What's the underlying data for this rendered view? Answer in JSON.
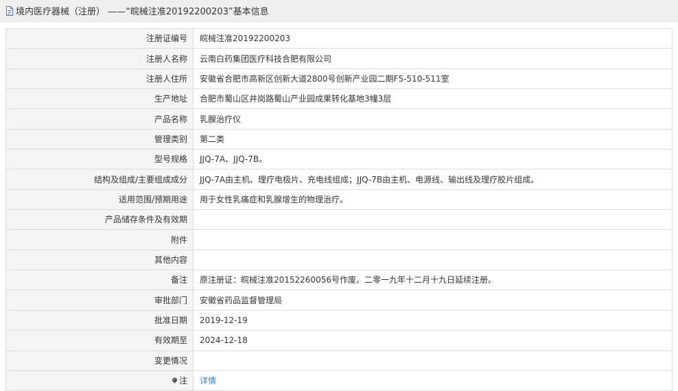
{
  "header": {
    "title": "境内医疗器械（注册） ——“皖械注准20192200203”基本信息"
  },
  "rows": [
    {
      "label": "注册证编号",
      "value": "皖械注准20192200203"
    },
    {
      "label": "注册人名称",
      "value": "云南白药集团医疗科技合肥有限公司"
    },
    {
      "label": "注册人住所",
      "value": "安徽省合肥市高新区创新大道2800号创新产业园二期F5-510-511室"
    },
    {
      "label": "生产地址",
      "value": "合肥市蜀山区井岗路蜀山产业园成果转化基地3幢3层"
    },
    {
      "label": "产品名称",
      "value": "乳腺治疗仪"
    },
    {
      "label": "管理类别",
      "value": "第二类"
    },
    {
      "label": "型号规格",
      "value": "JJQ-7A、JJQ-7B。"
    },
    {
      "label": "结构及组成/主要组成成分",
      "value": "JJQ-7A由主机、理疗电极片、充电线组成；JJQ-7B由主机、电源线、输出线及理疗胶片组成。"
    },
    {
      "label": "适用范围/预期用途",
      "value": "用于女性乳痛症和乳腺增生的物理治疗。"
    },
    {
      "label": "产品储存条件及有效期",
      "value": ""
    },
    {
      "label": "附件",
      "value": ""
    },
    {
      "label": "其他内容",
      "value": ""
    },
    {
      "label": "备注",
      "value": "原注册证：皖械注准20152260056号作废。二零一九年十二月十九日延续注册。"
    },
    {
      "label": "审批部门",
      "value": "安徽省药品监督管理局"
    },
    {
      "label": "批准日期",
      "value": "2019-12-19"
    },
    {
      "label": "有效期至",
      "value": "2024-12-18"
    },
    {
      "label": "变更情况",
      "value": ""
    }
  ],
  "note_row": {
    "label": "注",
    "link": "详情"
  },
  "colors": {
    "link": "#3a7fc1",
    "label_bg": "#f5f5f5",
    "border": "#dcdcdc"
  }
}
